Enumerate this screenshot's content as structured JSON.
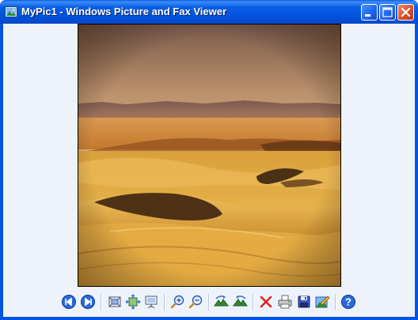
{
  "window": {
    "title": "MyPic1 - Windows Picture and Fax Viewer",
    "icon": "picture-viewer-icon",
    "controls": [
      "minimize-icon",
      "maximize-icon",
      "close-icon"
    ]
  },
  "image": {
    "name": "MyPic1",
    "subject": "desert sand dunes at sunset"
  },
  "toolbar": {
    "buttons": [
      "previous-image-icon",
      "next-image-icon",
      "best-fit-icon",
      "actual-size-icon",
      "slide-show-icon",
      "zoom-in-icon",
      "zoom-out-icon",
      "rotate-clockwise-icon",
      "rotate-counterclockwise-icon",
      "delete-icon",
      "print-icon",
      "save-icon",
      "edit-icon",
      "help-icon"
    ]
  },
  "colors": {
    "title_bar": "#0054e3",
    "frame_border": "#0054e3",
    "client_background": "#eef3fb",
    "close_button": "#d8522e"
  }
}
